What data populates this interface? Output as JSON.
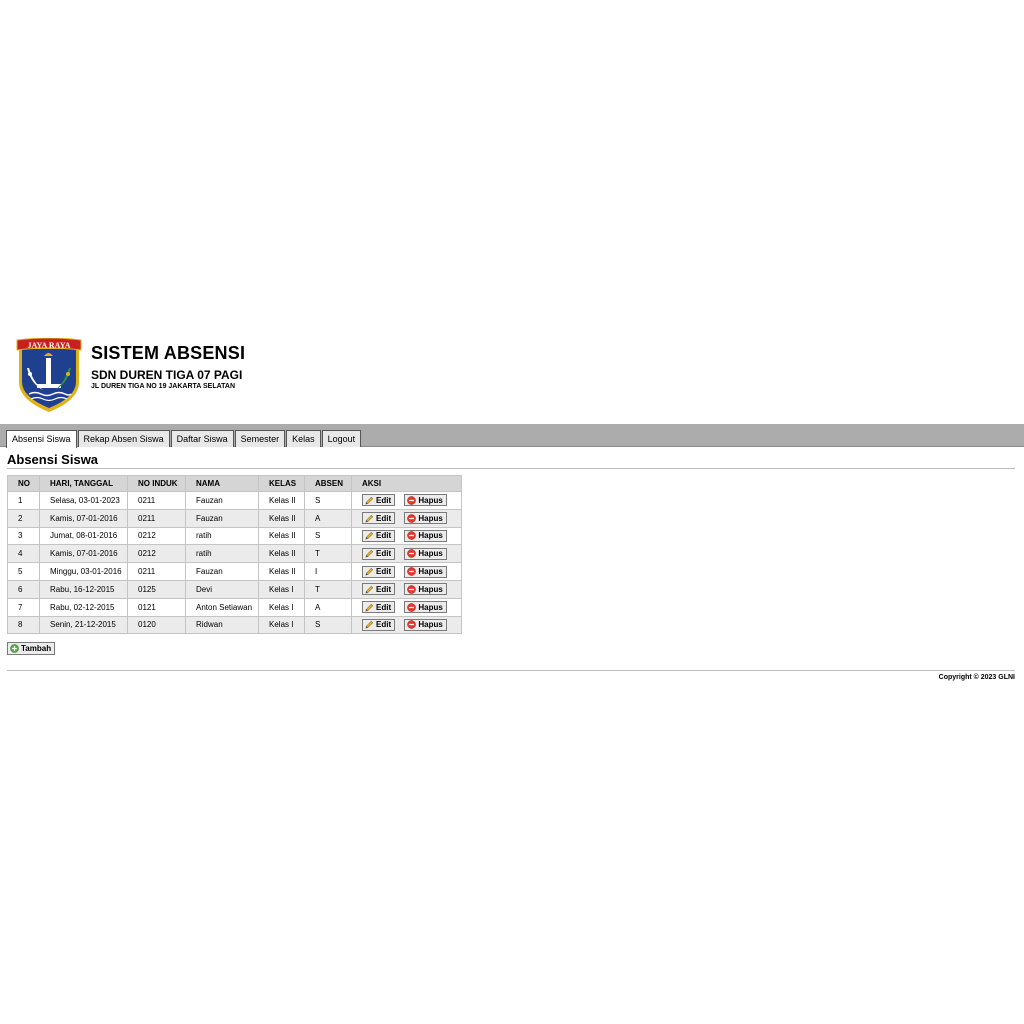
{
  "header": {
    "logo_text": "JAYA RAYA",
    "system_title": "SISTEM ABSENSI",
    "school_name": "SDN DUREN TIGA 07 PAGI",
    "school_address": "JL DUREN TIGA NO 19 JAKARTA SELATAN"
  },
  "nav": {
    "tabs": [
      {
        "label": "Absensi Siswa",
        "active": true
      },
      {
        "label": "Rekap Absen Siswa"
      },
      {
        "label": "Daftar Siswa"
      },
      {
        "label": "Semester"
      },
      {
        "label": "Kelas"
      },
      {
        "label": "Logout"
      }
    ]
  },
  "page": {
    "title": "Absensi Siswa"
  },
  "table": {
    "headers": {
      "no": "NO",
      "tanggal": "HARI, TANGGAL",
      "no_induk": "NO INDUK",
      "nama": "NAMA",
      "kelas": "KELAS",
      "absen": "ABSEN",
      "aksi": "AKSI"
    },
    "edit_label": "Edit",
    "hapus_label": "Hapus",
    "rows": [
      {
        "no": "1",
        "tanggal": "Selasa, 03-01-2023",
        "no_induk": "0211",
        "nama": "Fauzan",
        "kelas": "Kelas II",
        "absen": "S"
      },
      {
        "no": "2",
        "tanggal": "Kamis, 07-01-2016",
        "no_induk": "0211",
        "nama": "Fauzan",
        "kelas": "Kelas II",
        "absen": "A"
      },
      {
        "no": "3",
        "tanggal": "Jumat, 08-01-2016",
        "no_induk": "0212",
        "nama": "ratih",
        "kelas": "Kelas II",
        "absen": "S"
      },
      {
        "no": "4",
        "tanggal": "Kamis, 07-01-2016",
        "no_induk": "0212",
        "nama": "ratih",
        "kelas": "Kelas II",
        "absen": "T"
      },
      {
        "no": "5",
        "tanggal": "Minggu, 03-01-2016",
        "no_induk": "0211",
        "nama": "Fauzan",
        "kelas": "Kelas II",
        "absen": "I"
      },
      {
        "no": "6",
        "tanggal": "Rabu, 16-12-2015",
        "no_induk": "0125",
        "nama": "Devi",
        "kelas": "Kelas I",
        "absen": "T"
      },
      {
        "no": "7",
        "tanggal": "Rabu, 02-12-2015",
        "no_induk": "0121",
        "nama": "Anton Setiawan",
        "kelas": "Kelas I",
        "absen": "A"
      },
      {
        "no": "8",
        "tanggal": "Senin, 21-12-2015",
        "no_induk": "0120",
        "nama": "Ridwan",
        "kelas": "Kelas I",
        "absen": "S"
      }
    ]
  },
  "actions": {
    "tambah_label": "Tambah"
  },
  "footer": {
    "copyright": "Copyright © 2023 GLNI"
  },
  "colors": {
    "nav_bar": "#acacac",
    "tab_bg": "#e8e8e8",
    "header_row": "#d5d5d5",
    "row_alt": "#ebebeb",
    "logo_blue": "#1f3f8f",
    "logo_red": "#c8201e",
    "logo_gold": "#e0b21a"
  },
  "icons": {
    "edit": "pencil-icon",
    "hapus": "delete-circle-icon",
    "tambah": "add-circle-icon"
  }
}
